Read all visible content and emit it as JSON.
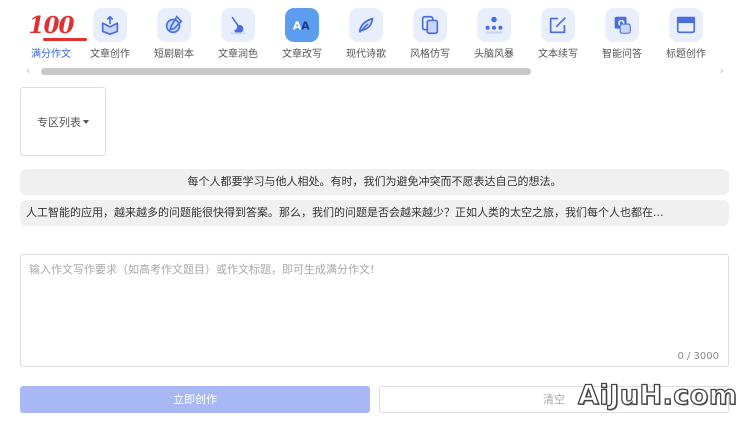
{
  "toolbar": {
    "items": [
      {
        "label": "满分作文",
        "icon": "hundred-icon",
        "active": true
      },
      {
        "label": "文章创作",
        "icon": "box-arrow-icon"
      },
      {
        "label": "短剧剧本",
        "icon": "film-pen-icon"
      },
      {
        "label": "文章润色",
        "icon": "brush-icon"
      },
      {
        "label": "文章改写",
        "icon": "translate-icon"
      },
      {
        "label": "现代诗歌",
        "icon": "quill-icon"
      },
      {
        "label": "风格仿写",
        "icon": "copy-doc-icon"
      },
      {
        "label": "头脑风暴",
        "icon": "team-icon"
      },
      {
        "label": "文本续写",
        "icon": "edit-box-icon"
      },
      {
        "label": "智能问答",
        "icon": "qa-icon"
      },
      {
        "label": "标题创作",
        "icon": "title-window-icon"
      }
    ],
    "hundred_glyph": "100"
  },
  "scrollbar": {
    "left_arrow": "‹",
    "right_arrow": "›"
  },
  "zone_dropdown": {
    "label": "专区列表"
  },
  "examples": [
    "每个人都要学习与他人相处。有时，我们为避免冲突而不愿表达自己的想法。",
    "人工智能的应用，越来越多的问题能很快得到答案。那么，我们的问题是否会越来越少？正如人类的太空之旅，我们每个人也都在..."
  ],
  "input": {
    "placeholder": "输入作文写作要求（如高考作文题目）或作文标题，即可生成满分作文!",
    "value": "",
    "counter": "0 / 3000"
  },
  "actions": {
    "generate_label": "立即创作",
    "clear_label": "清空"
  },
  "watermark": "AiJuH.com",
  "colors": {
    "accent": "#3a66e0",
    "primary_button": "#a7b8f4",
    "icon_bg": "#e8eefb",
    "brand_red": "#e03030"
  }
}
